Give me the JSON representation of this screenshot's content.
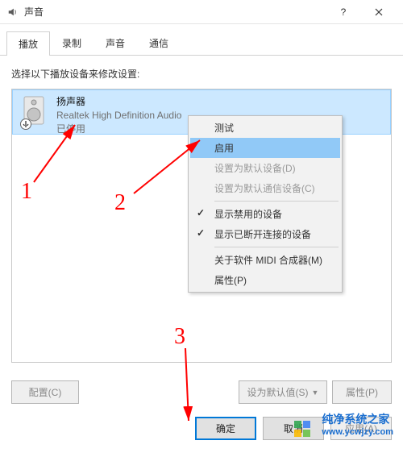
{
  "window": {
    "title": "声音",
    "icon": "speaker-icon"
  },
  "tabs": {
    "items": [
      {
        "label": "播放",
        "active": true
      },
      {
        "label": "录制",
        "active": false
      },
      {
        "label": "声音",
        "active": false
      },
      {
        "label": "通信",
        "active": false
      }
    ]
  },
  "instruction": "选择以下播放设备来修改设置:",
  "device": {
    "name": "扬声器",
    "sub": "Realtek High Definition Audio",
    "status": "已停用"
  },
  "context_menu": {
    "items": [
      {
        "label": "测试",
        "type": "item"
      },
      {
        "label": "启用",
        "type": "item",
        "highlight": true
      },
      {
        "label": "设置为默认设备(D)",
        "type": "item",
        "disabled": true
      },
      {
        "label": "设置为默认通信设备(C)",
        "type": "item",
        "disabled": true
      },
      {
        "type": "sep"
      },
      {
        "label": "显示禁用的设备",
        "type": "item",
        "checked": true
      },
      {
        "label": "显示已断开连接的设备",
        "type": "item",
        "checked": true
      },
      {
        "type": "sep"
      },
      {
        "label": "关于软件 MIDI 合成器(M)",
        "type": "item"
      },
      {
        "label": "属性(P)",
        "type": "item"
      }
    ]
  },
  "buttons": {
    "configure": "配置(C)",
    "set_default": "设为默认值(S)",
    "properties": "属性(P)",
    "ok": "确定",
    "cancel": "取消",
    "apply": "应用(A)"
  },
  "annotations": {
    "a1": "1",
    "a2": "2",
    "a3": "3"
  },
  "watermark": {
    "text1": "纯净系统之家",
    "text2": "www.ycwjzy.com"
  }
}
